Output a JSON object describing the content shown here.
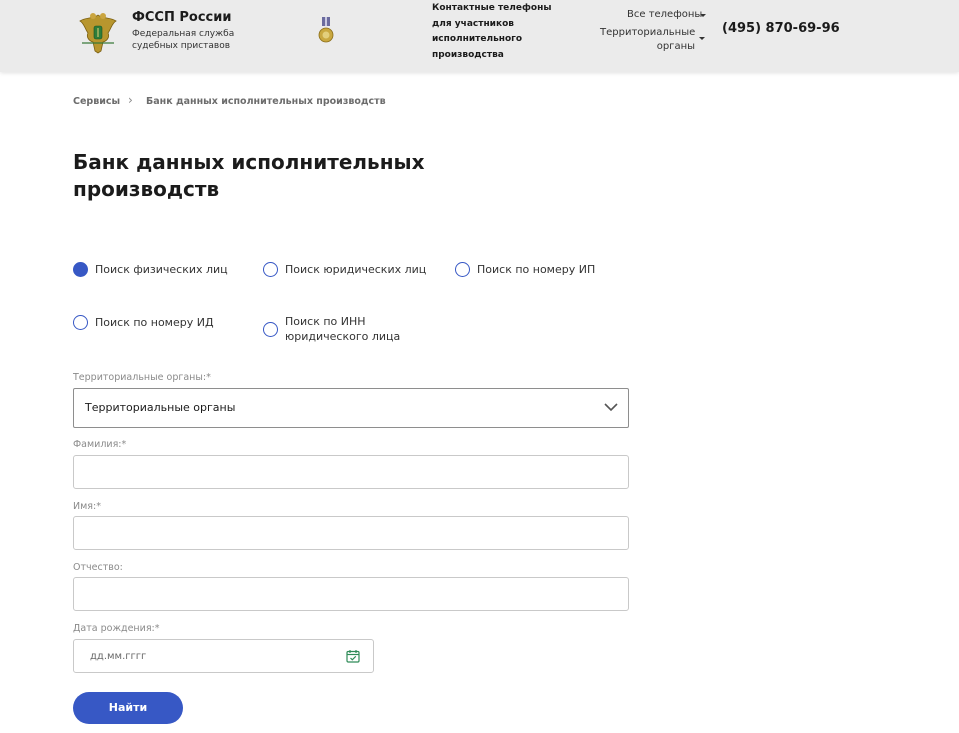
{
  "header": {
    "brand_name": "ФССП России",
    "brand_subtitle": "Федеральная служба судебных приставов",
    "contacts_title": "Контактные телефоны для участников исполнительного производства",
    "all_phones_label": "Все телефоны",
    "territorial_label": "Территориальные органы",
    "phone": "(495) 870-69-96"
  },
  "breadcrumb": {
    "items": [
      "Сервисы",
      "Банк данных исполнительных производств"
    ],
    "separator": "›"
  },
  "page_title": "Банк данных исполнительных производств",
  "search_types": [
    {
      "label": "Поиск физических лиц",
      "checked": true
    },
    {
      "label": "Поиск юридических лиц",
      "checked": false
    },
    {
      "label": "Поиск по номеру ИП",
      "checked": false
    },
    {
      "label": "Поиск по номеру ИД",
      "checked": false
    },
    {
      "label": "Поиск по ИНН юридического лица",
      "checked": false
    }
  ],
  "form": {
    "territorial": {
      "label": "Территориальные органы:*",
      "value": "Территориальные органы"
    },
    "lastname": {
      "label": "Фамилия:*",
      "value": ""
    },
    "firstname": {
      "label": "Имя:*",
      "value": ""
    },
    "patronymic": {
      "label": "Отчество:",
      "value": ""
    },
    "birthdate": {
      "label": "Дата рождения:*",
      "placeholder": "дд.мм.гггг"
    },
    "submit_label": "Найти"
  },
  "colors": {
    "accent": "#3758c5",
    "header_bg": "#ebebeb",
    "calendar_icon": "#2e8b57"
  },
  "icons": {
    "emblem": "eagle-emblem-icon",
    "medal": "medal-icon",
    "dropdown": "chevron-down-icon",
    "calendar": "calendar-icon"
  }
}
